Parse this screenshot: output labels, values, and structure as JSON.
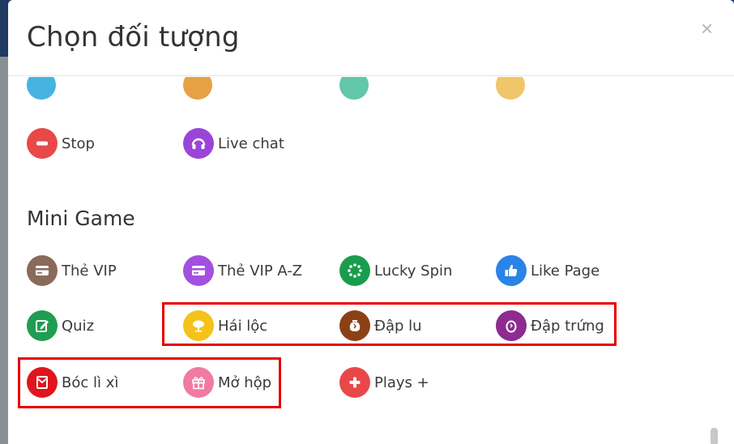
{
  "modal": {
    "title": "Chọn đối tượng",
    "close_symbol": "×"
  },
  "partial_row_colors": [
    "#46b4e0",
    "#e7a145",
    "#62c6a8",
    "#f0c66a"
  ],
  "top_items": [
    {
      "label": "Stop",
      "icon": "minus-circle-icon",
      "color": "#e94848"
    },
    {
      "label": "Live chat",
      "icon": "headset-icon",
      "color": "#9b45d8"
    }
  ],
  "mini_game": {
    "title": "Mini Game",
    "items": [
      {
        "label": "Thẻ VIP",
        "icon": "card-icon",
        "color": "#8a6a5a"
      },
      {
        "label": "Thẻ VIP A-Z",
        "icon": "card-icon",
        "color": "#a34fe0"
      },
      {
        "label": "Lucky Spin",
        "icon": "spinner-icon",
        "color": "#1a9c4e"
      },
      {
        "label": "Like Page",
        "icon": "thumbs-up-icon",
        "color": "#2a83e6"
      },
      {
        "label": "Quiz",
        "icon": "edit-icon",
        "color": "#1f9d50"
      },
      {
        "label": "Hái lộc",
        "icon": "tree-icon",
        "color": "#f5c21b"
      },
      {
        "label": "Đập lu",
        "icon": "jar-icon",
        "color": "#8a4214"
      },
      {
        "label": "Đập trứng",
        "icon": "egg-icon",
        "color": "#8e2a90"
      },
      {
        "label": "Bóc lì xì",
        "icon": "envelope-icon",
        "color": "#e0151d"
      },
      {
        "label": "Mở hộp",
        "icon": "gift-icon",
        "color": "#f07aa4"
      },
      {
        "label": "Plays +",
        "icon": "plus-circle-icon",
        "color": "#e94848"
      }
    ]
  },
  "highlight_color": "#e60000"
}
